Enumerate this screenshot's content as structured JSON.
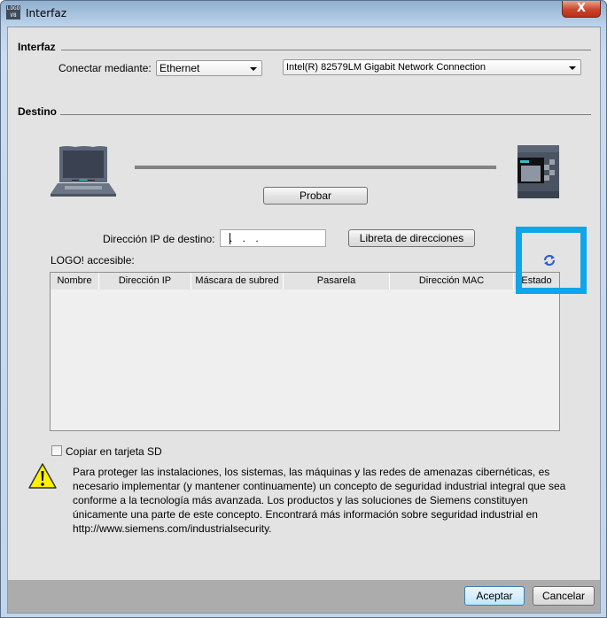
{
  "window": {
    "title": "Interfaz",
    "app_icon": "logo-soft-comfort-icon",
    "close_icon": "close-icon",
    "close_symbol": "X"
  },
  "interface_section": {
    "title": "Interfaz",
    "connect_via_label": "Conectar mediante:",
    "connect_via_value": "Ethernet",
    "adapter_value": "Intel(R) 82579LM Gigabit Network Connection"
  },
  "destination_section": {
    "title": "Destino",
    "pc_icon": "laptop-icon",
    "device_icon": "logo-plc-icon",
    "test_button": "Probar",
    "ip_label": "Dirección IP de destino:",
    "ip_value": ". . .",
    "address_book_button": "Libreta de direcciones",
    "accessible_label": "LOGO! accesible:",
    "refresh_icon": "refresh-icon",
    "table": {
      "columns": [
        "Nombre",
        "Dirección IP",
        "Máscara de subred",
        "Pasarela",
        "Dirección MAC",
        "Estado"
      ],
      "rows": []
    }
  },
  "sd_card": {
    "label": "Copiar en tarjeta SD",
    "checked": false
  },
  "warning": {
    "icon": "warning-icon",
    "text": "Para proteger las instalaciones, los sistemas, las máquinas y las redes de amenazas cibernéticas, es necesario implementar (y mantener continuamente) un concepto de seguridad industrial integral que sea conforme a la tecnología más avanzada. Los productos y las soluciones de Siemens constituyen únicamente una parte de este concepto. Encontrará más información sobre seguridad industrial en http://www.siemens.com/industrialsecurity."
  },
  "footer": {
    "accept_button": "Aceptar",
    "cancel_button": "Cancelar"
  },
  "annotation": {
    "highlight_color": "#0ea5e9"
  }
}
